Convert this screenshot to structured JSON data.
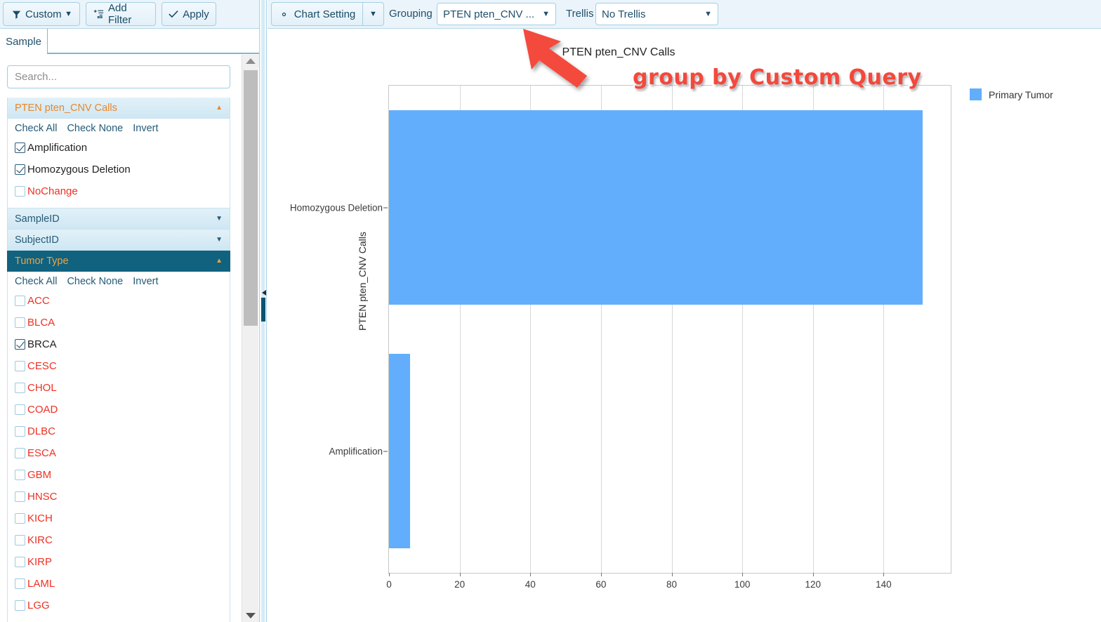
{
  "left_toolbar": {
    "custom_label": "Custom",
    "custom_icon": "filter-icon",
    "add_filter_label": "Add Filter",
    "add_filter_icon": "add-filter-icon",
    "apply_label": "Apply",
    "apply_icon": "check-icon",
    "caret": "▼"
  },
  "tabs": [
    {
      "label": "Sample",
      "active": true
    }
  ],
  "search": {
    "placeholder": "Search...",
    "value": ""
  },
  "accordion": {
    "actions": {
      "check_all": "Check All",
      "check_none": "Check None",
      "invert": "Invert"
    },
    "sections": [
      {
        "title": "PTEN pten_CNV Calls",
        "expanded": true,
        "style": "light",
        "arrow": "▲",
        "items": [
          {
            "label": "Amplification",
            "checked": true,
            "color": "dark"
          },
          {
            "label": "Homozygous Deletion",
            "checked": true,
            "color": "dark"
          },
          {
            "label": "NoChange",
            "checked": false,
            "color": "red"
          }
        ]
      },
      {
        "title": "SampleID",
        "expanded": false,
        "style": "light-plain",
        "arrow": "▼",
        "items": []
      },
      {
        "title": "SubjectID",
        "expanded": false,
        "style": "light-plain",
        "arrow": "▼",
        "items": []
      },
      {
        "title": "Tumor Type",
        "expanded": true,
        "style": "dark",
        "arrow": "▲",
        "items": [
          {
            "label": "ACC",
            "checked": false,
            "color": "red"
          },
          {
            "label": "BLCA",
            "checked": false,
            "color": "red"
          },
          {
            "label": "BRCA",
            "checked": true,
            "color": "dark"
          },
          {
            "label": "CESC",
            "checked": false,
            "color": "red"
          },
          {
            "label": "CHOL",
            "checked": false,
            "color": "red"
          },
          {
            "label": "COAD",
            "checked": false,
            "color": "red"
          },
          {
            "label": "DLBC",
            "checked": false,
            "color": "red"
          },
          {
            "label": "ESCA",
            "checked": false,
            "color": "red"
          },
          {
            "label": "GBM",
            "checked": false,
            "color": "red"
          },
          {
            "label": "HNSC",
            "checked": false,
            "color": "red"
          },
          {
            "label": "KICH",
            "checked": false,
            "color": "red"
          },
          {
            "label": "KIRC",
            "checked": false,
            "color": "red"
          },
          {
            "label": "KIRP",
            "checked": false,
            "color": "red"
          },
          {
            "label": "LAML",
            "checked": false,
            "color": "red"
          },
          {
            "label": "LGG",
            "checked": false,
            "color": "red"
          }
        ]
      }
    ]
  },
  "chart_toolbar": {
    "chart_setting_label": "Chart Setting",
    "chart_setting_icon": "gear-icon",
    "caret": "▼",
    "grouping_label": "Grouping",
    "grouping_value": "PTEN pten_CNV ...",
    "trellis_label": "Trellis",
    "trellis_value": "No Trellis"
  },
  "annotation": {
    "text": "group by Custom Query",
    "color": "#f4483c"
  },
  "legend": {
    "entries": [
      {
        "label": "Primary Tumor",
        "color": "#62aefd"
      }
    ]
  },
  "chart_data": {
    "type": "bar",
    "orientation": "horizontal",
    "title": "PTEN pten_CNV Calls",
    "xlabel": "",
    "ylabel": "PTEN pten_CNV Calls",
    "categories": [
      "Amplification",
      "Homozygous Deletion"
    ],
    "series": [
      {
        "name": "Primary Tumor",
        "color": "#62aefd",
        "values": [
          6,
          151
        ]
      }
    ],
    "xlim": [
      0,
      159
    ],
    "xticks": [
      0,
      20,
      40,
      60,
      80,
      100,
      120,
      140
    ],
    "grid": true,
    "legend_position": "right"
  }
}
